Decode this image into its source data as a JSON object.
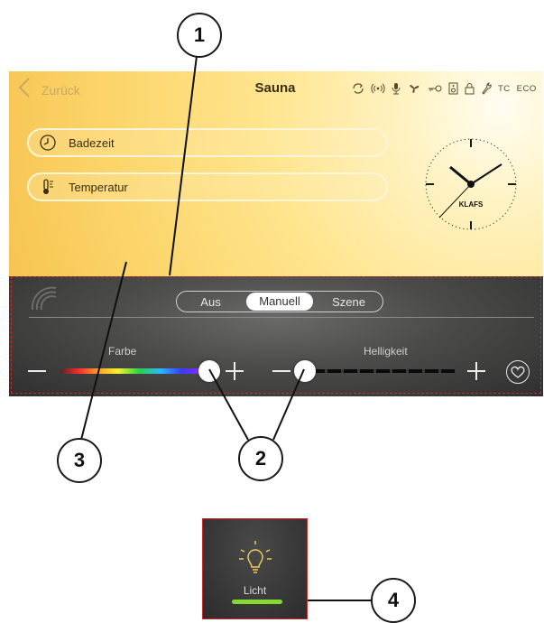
{
  "header": {
    "back_label": "Zurück",
    "title": "Sauna",
    "status_icons": [
      "sync-icon",
      "wireless-icon",
      "microphone-icon",
      "fan-icon",
      "key-icon",
      "speaker-icon",
      "lock-icon",
      "wrench-icon"
    ],
    "tc_label": "TC",
    "eco_label": "ECO"
  },
  "menu": {
    "items": [
      {
        "label": "Badezeit",
        "icon": "clock-icon"
      },
      {
        "label": "Temperatur",
        "icon": "thermometer-icon"
      }
    ]
  },
  "clock": {
    "brand": "KLAFS",
    "time": "10:08"
  },
  "light_control": {
    "modes": [
      "Aus",
      "Manuell",
      "Szene"
    ],
    "selected_mode": "Manuell",
    "color_label": "Farbe",
    "brightness_label": "Helligkeit",
    "color_position": 1.0,
    "brightness_level": 0.0
  },
  "callouts": [
    "1",
    "2",
    "3",
    "4"
  ],
  "tile": {
    "label": "Licht",
    "icon": "light-bulb-icon",
    "status_color": "#86d832"
  },
  "colors": {
    "accent_red": "#cc2b2b",
    "active_green": "#86d832"
  }
}
